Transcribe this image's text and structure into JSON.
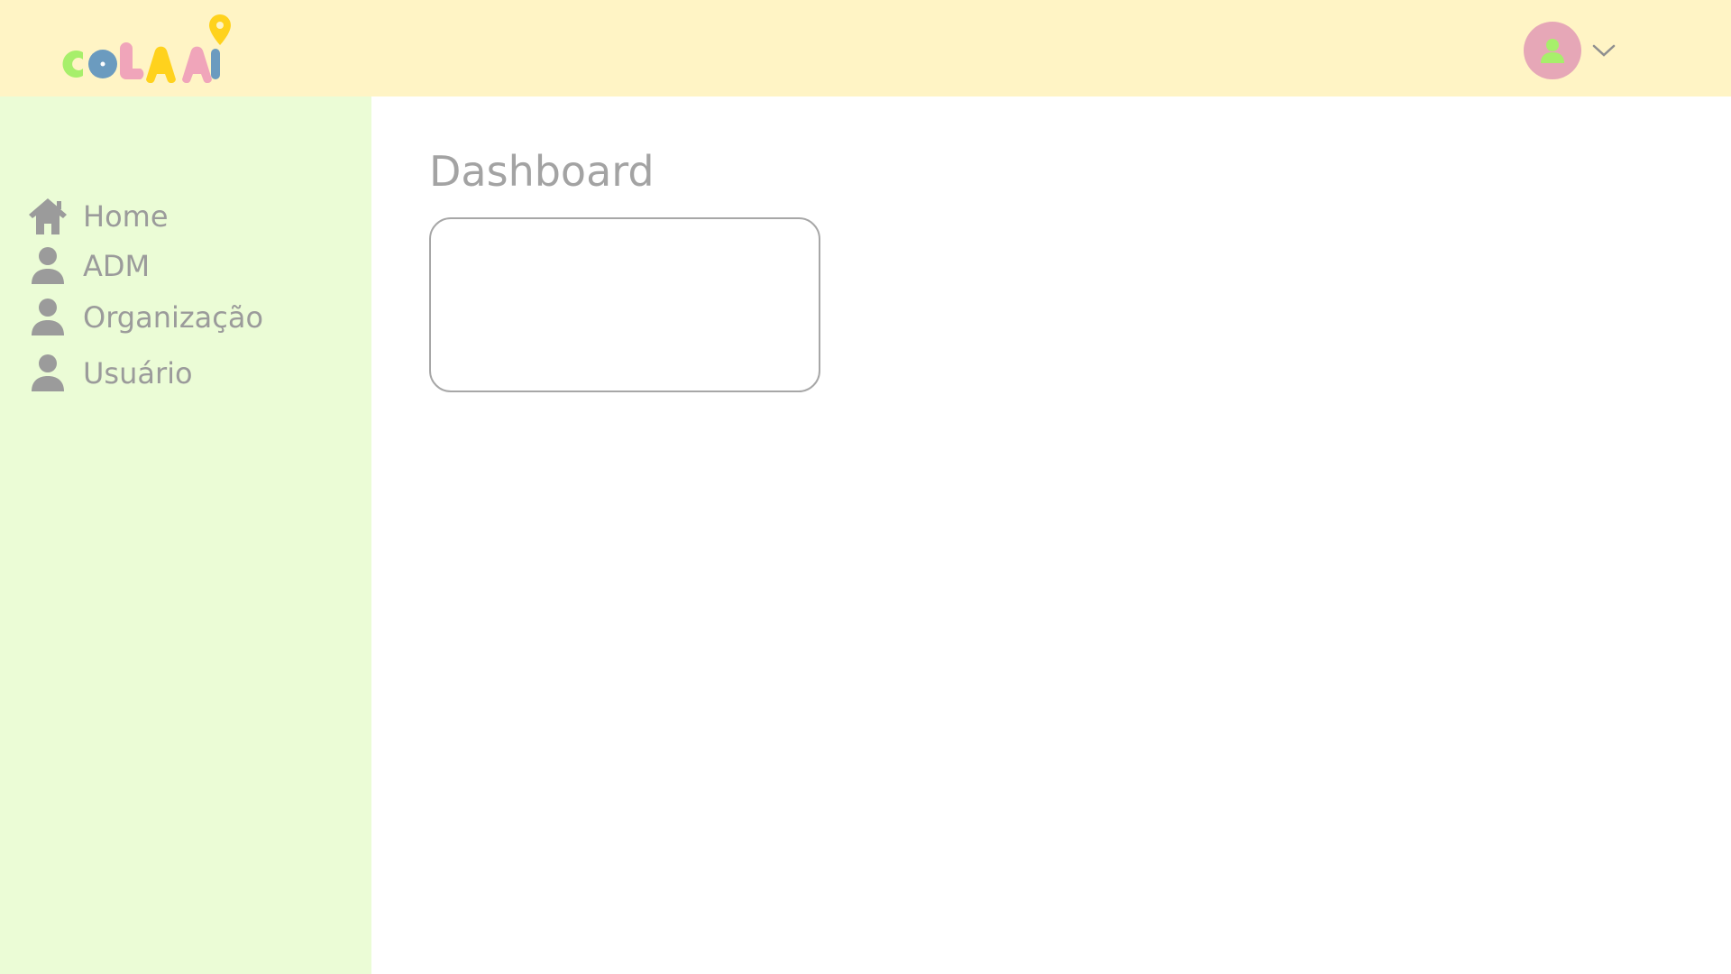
{
  "brand": {
    "name": "COLA AÍ",
    "colors": {
      "green": "#a7ef6b",
      "blue": "#6b9bbf",
      "pink": "#f0a5ba",
      "yellow": "#ffd21d"
    }
  },
  "header": {
    "background": "#fff4c5",
    "avatar_icon": "user-icon",
    "avatar_color": "#e6a7b7",
    "dropdown_icon": "chevron-down-icon"
  },
  "sidebar": {
    "background": "#ebfcd6",
    "items": [
      {
        "label": "Home",
        "icon": "home-icon"
      },
      {
        "label": "ADM",
        "icon": "user-icon"
      },
      {
        "label": "Organização",
        "icon": "user-icon"
      },
      {
        "label": "Usuário",
        "icon": "user-icon"
      }
    ]
  },
  "main": {
    "title": "Dashboard"
  }
}
